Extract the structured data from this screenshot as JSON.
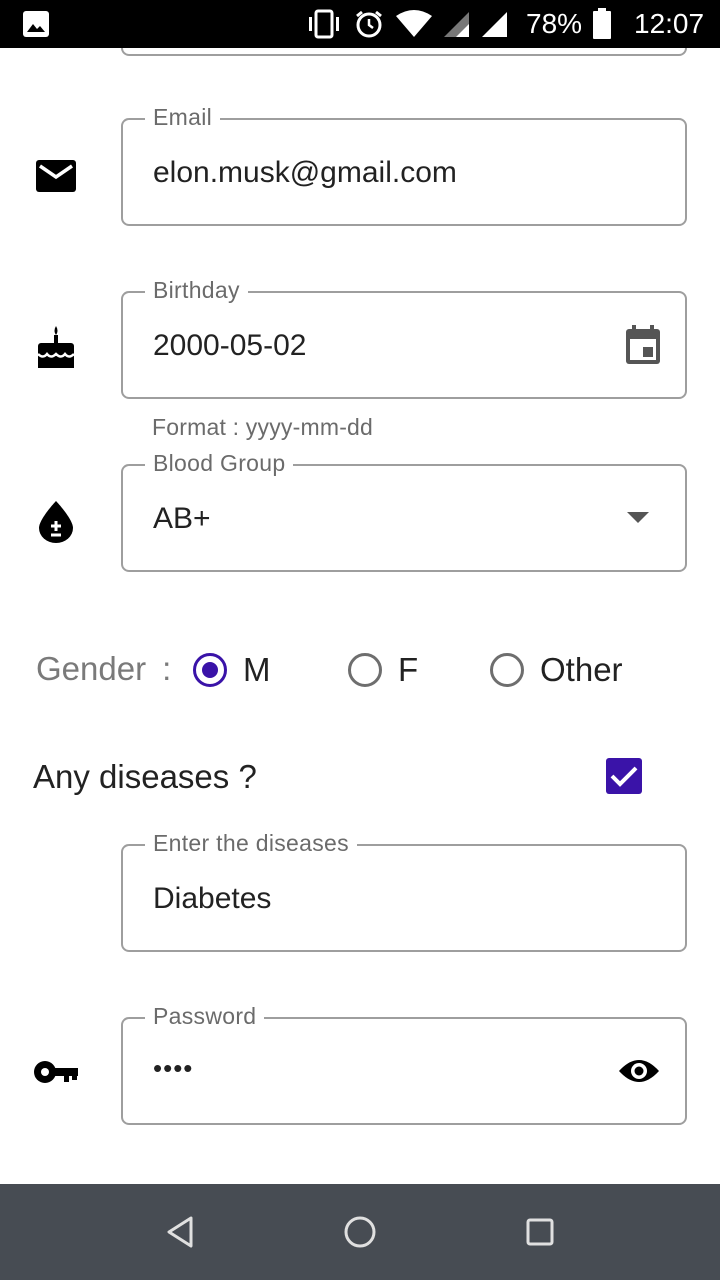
{
  "status_bar": {
    "icons": [
      "gallery-icon",
      "vibrate-icon",
      "alarm-icon",
      "wifi-icon",
      "signal-icon",
      "signal-icon",
      "battery-icon"
    ],
    "battery": "78%",
    "time": "12:07"
  },
  "form": {
    "email": {
      "label": "Email",
      "value": "elon.musk@gmail.com",
      "icon": "mail-icon"
    },
    "birthday": {
      "label": "Birthday",
      "value": "2000-05-02",
      "helper": "Format : yyyy-mm-dd",
      "icon": "cake-icon",
      "trailing_icon": "calendar-icon"
    },
    "blood_group": {
      "label": "Blood Group",
      "value": "AB+",
      "icon": "blood-drop-icon",
      "trailing_icon": "dropdown-arrow-icon"
    },
    "gender": {
      "label": "Gender",
      "separator": ":",
      "options": [
        "M",
        "F",
        "Other"
      ],
      "selected": "M"
    },
    "diseases": {
      "question": "Any diseases ?",
      "checked": true,
      "label": "Enter the diseases",
      "value": "Diabetes"
    },
    "password": {
      "label": "Password",
      "value": "••••",
      "icon": "key-icon",
      "trailing_icon": "eye-icon"
    }
  },
  "colors": {
    "accent": "#3a13a8",
    "outline": "#9e9e9e",
    "navbar": "#474c53"
  },
  "nav_bar": {
    "icons": [
      "back-icon",
      "home-icon",
      "recents-icon"
    ]
  }
}
